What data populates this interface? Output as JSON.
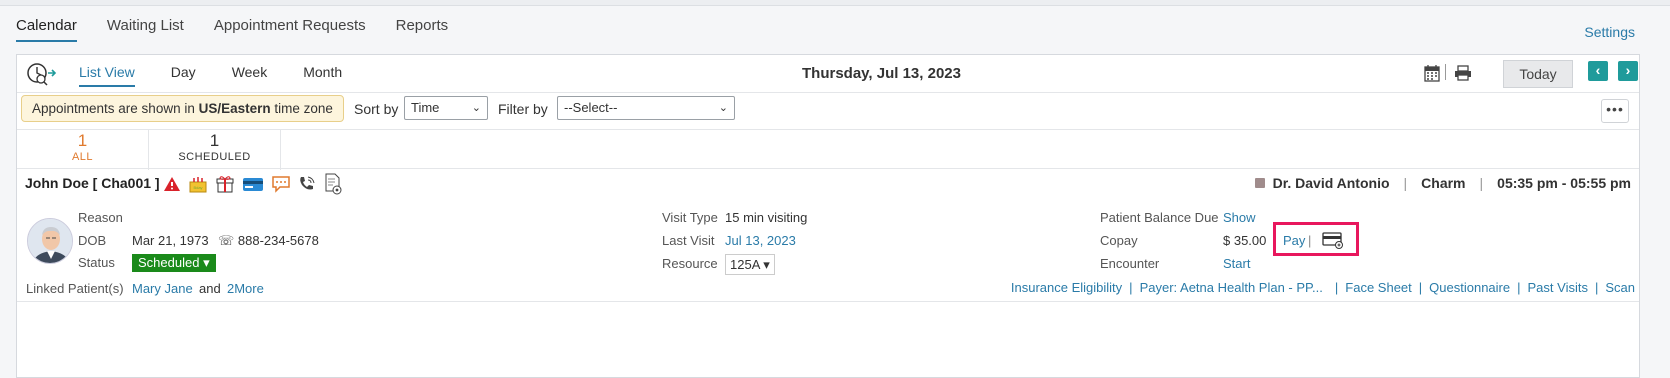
{
  "topnav": {
    "tabs": [
      "Calendar",
      "Waiting List",
      "Appointment Requests",
      "Reports"
    ],
    "settings": "Settings"
  },
  "toolbar": {
    "views": [
      "List View",
      "Day",
      "Week",
      "Month"
    ],
    "date": "Thursday, Jul 13, 2023",
    "today": "Today",
    "prev": "‹",
    "next": "›"
  },
  "filters": {
    "tz_prefix": "Appointments are shown in",
    "tz_name": "US/Eastern",
    "tz_suffix": "time zone",
    "sort_label": "Sort by",
    "sort_value": "Time",
    "filter_label": "Filter by",
    "filter_value": "--Select--",
    "more": "•••"
  },
  "counts": [
    {
      "num": "1",
      "label": "ALL"
    },
    {
      "num": "1",
      "label": "SCHEDULED"
    }
  ],
  "appointment": {
    "patient": "John Doe [ Cha001 ]",
    "provider": "Dr. David Antonio",
    "facility": "Charm",
    "time": "05:35 pm - 05:55 pm",
    "reason_label": "Reason",
    "dob_label": "DOB",
    "dob": "Mar 21, 1973",
    "phone": "888-234-5678",
    "status_label": "Status",
    "status": "Scheduled",
    "linked_label": "Linked Patient(s)",
    "linked_name": "Mary Jane",
    "linked_and": "and",
    "linked_more": "2More",
    "visit_type_label": "Visit Type",
    "visit_type": "15 min visiting",
    "last_visit_label": "Last Visit",
    "last_visit": "Jul 13, 2023",
    "resource_label": "Resource",
    "resource": "125A",
    "balance_label": "Patient Balance Due",
    "balance_value": "Show",
    "copay_label": "Copay",
    "copay": "$ 35.00",
    "pay": "Pay",
    "encounter_label": "Encounter",
    "encounter": "Start"
  },
  "links": [
    "Insurance Eligibility",
    "Payer: Aetna Health Plan - PP...",
    "Face Sheet",
    "Questionnaire",
    "Past Visits",
    "Scan"
  ],
  "colors": {
    "accent": "#2a7ba8",
    "teal": "#1f9b9b",
    "status": "#1a8a1a",
    "highlight": "#e8175d",
    "count_orange": "#e07a2e"
  }
}
